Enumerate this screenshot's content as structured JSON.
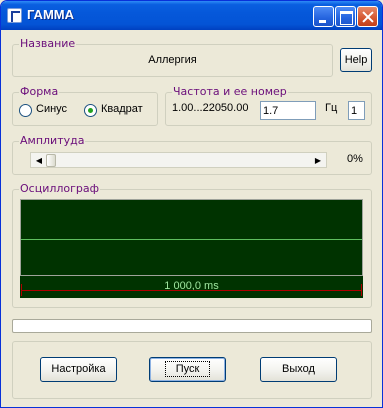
{
  "window": {
    "title": "ГАММА"
  },
  "name_group": {
    "label": "Название",
    "value": "Аллергия",
    "help_button": "Help"
  },
  "form_group": {
    "label": "Форма",
    "options": [
      {
        "label": "Синус",
        "checked": false
      },
      {
        "label": "Квадрат",
        "checked": true
      }
    ]
  },
  "freq_group": {
    "label": "Частота и ее номер",
    "range": "1.00...22050.00",
    "value": "1.7",
    "unit": "Гц",
    "number": "1"
  },
  "amp_group": {
    "label": "Амплитуда",
    "value": "0%",
    "level_percent": 0
  },
  "scope_group": {
    "label": "Осциллограф",
    "time": "1 000,0 ms",
    "background_color": "#003300",
    "trace_color": "#5FBF5F",
    "marker_color": "#B00000"
  },
  "progress": {
    "value_percent": 0
  },
  "buttons": {
    "settings": "Настройка",
    "start": "Пуск",
    "exit": "Выход"
  }
}
